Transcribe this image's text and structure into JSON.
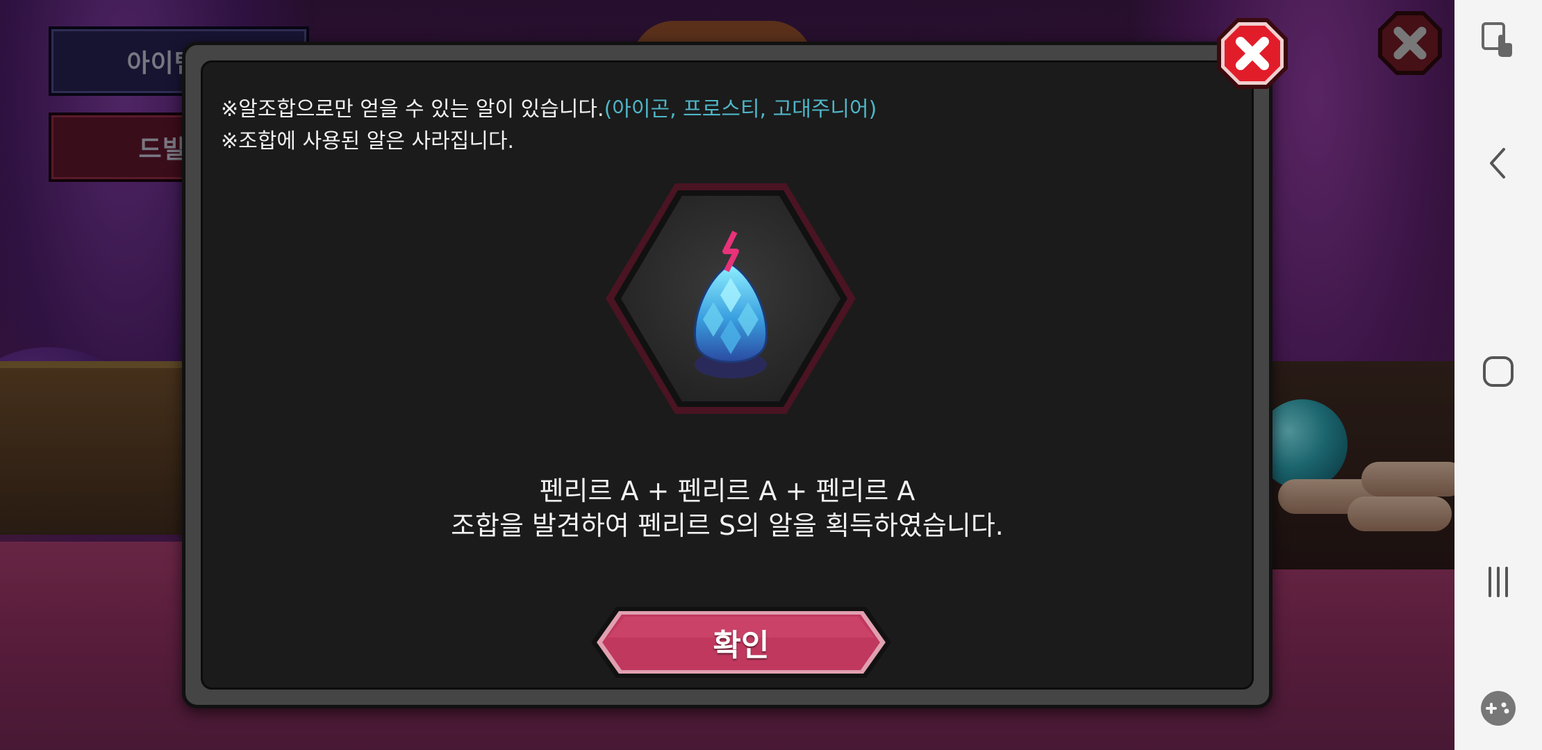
{
  "background": {
    "item_code_button": "아이템 코",
    "dribble_button": "드빌 가"
  },
  "dialog": {
    "notes": {
      "line1_main": "※알조합으로만 얻을 수 있는 알이 있습니다.",
      "line1_highlight": "(아이곤, 프로스티, 고대주니어)",
      "line2": "※조합에 사용된 알은 사라집니다."
    },
    "egg_icon": "egg-icon",
    "result": {
      "line1": "펜리르 A + 펜리르 A + 펜리르 A",
      "line2": "조합을 발견하여 펜리르 S의 알을 획득하였습니다."
    },
    "confirm_label": "확인"
  },
  "colors": {
    "highlight_text": "#4fb6c8",
    "confirm_button": "#c0385e",
    "close_button": "#e21d2a",
    "hex_border": "#5a1a2a"
  },
  "navbar": {
    "icons": [
      "screenshot-tap-icon",
      "back-icon",
      "home-icon",
      "recents-icon",
      "game-tools-icon"
    ]
  }
}
